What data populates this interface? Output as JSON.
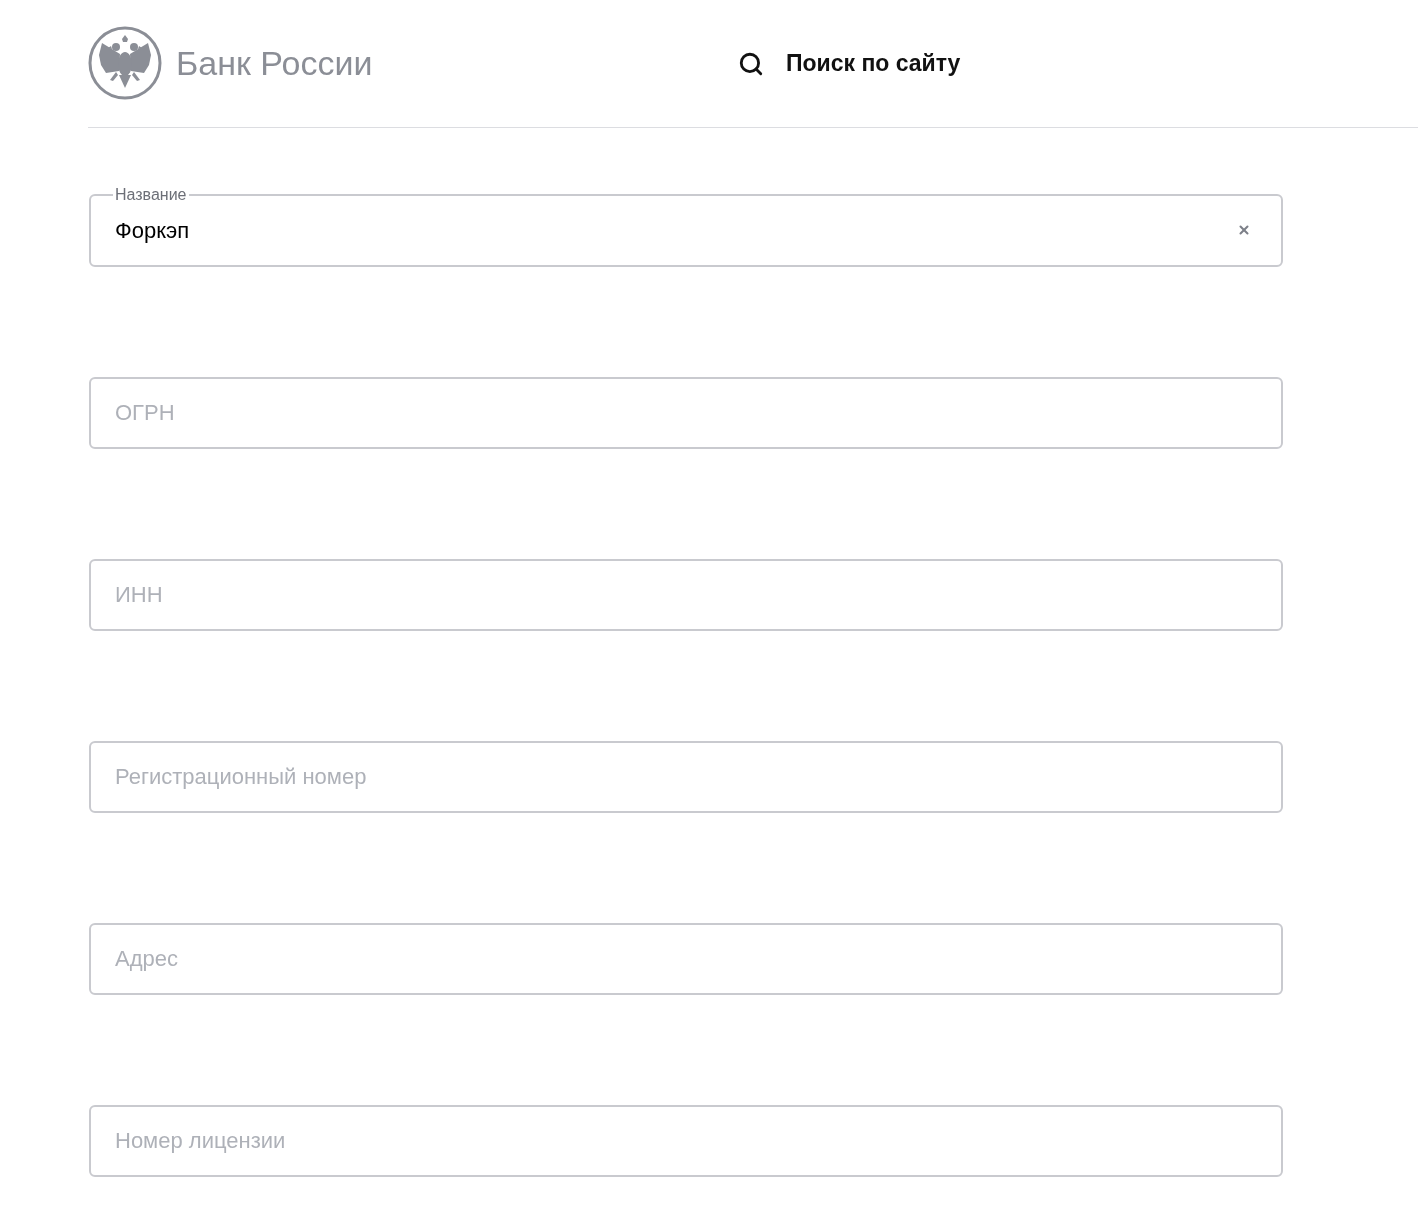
{
  "header": {
    "logo": {
      "text": "Банк России"
    },
    "search": {
      "label": "Поиск по сайту"
    }
  },
  "form": {
    "fields": [
      {
        "kind": "filled",
        "label": "Название",
        "value": "Форкэп"
      },
      {
        "kind": "empty",
        "placeholder": "ОГРН"
      },
      {
        "kind": "empty",
        "placeholder": "ИНН"
      },
      {
        "kind": "empty",
        "placeholder": "Регистрационный номер"
      },
      {
        "kind": "empty",
        "placeholder": "Адрес"
      },
      {
        "kind": "empty",
        "placeholder": "Номер лицензии"
      }
    ]
  }
}
